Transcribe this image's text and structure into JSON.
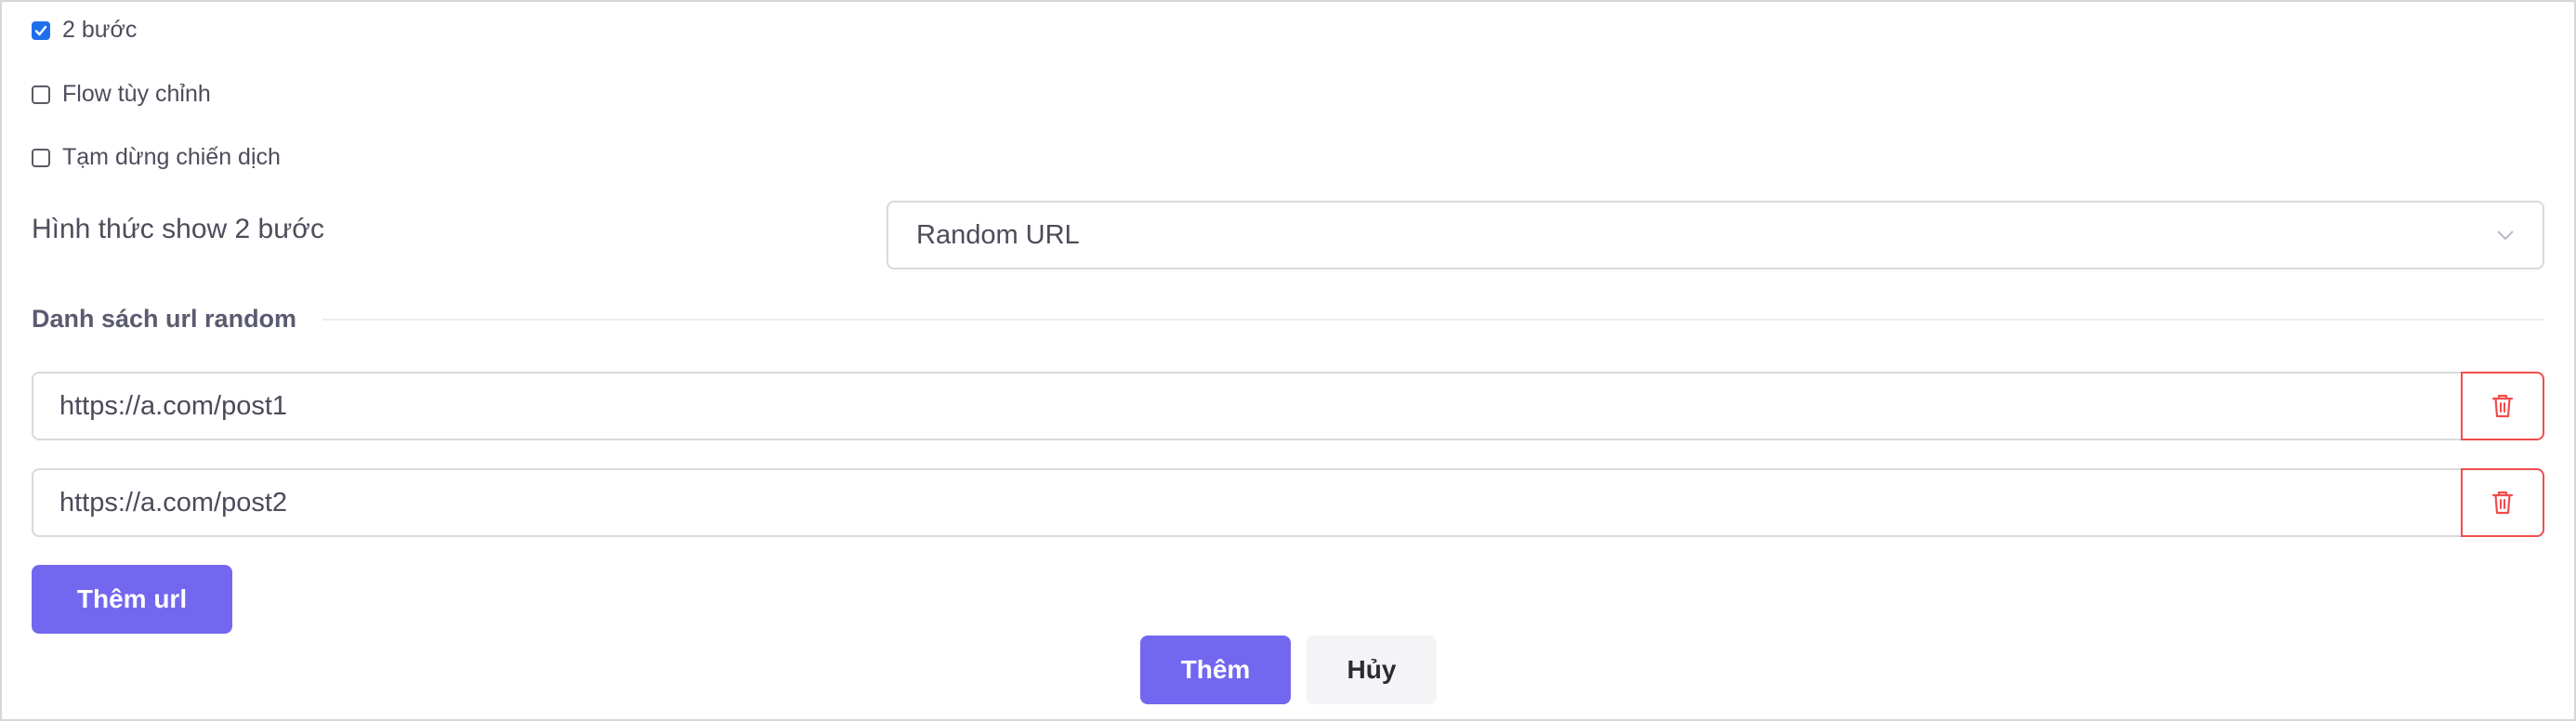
{
  "options": {
    "two_step": {
      "label": "2 bước",
      "checked": true
    },
    "custom_flow": {
      "label": "Flow tùy chỉnh",
      "checked": false
    },
    "pause_campaign": {
      "label": "Tạm dừng chiến dịch",
      "checked": false
    }
  },
  "display_mode": {
    "label": "Hình thức show 2 bước",
    "selected": "Random URL"
  },
  "url_list": {
    "title": "Danh sách url random",
    "items": [
      "https://a.com/post1",
      "https://a.com/post2"
    ],
    "add_label": "Thêm url"
  },
  "footer": {
    "submit_label": "Thêm",
    "cancel_label": "Hủy"
  },
  "colors": {
    "primary": "#7367f0",
    "danger": "#ef4d4d",
    "checkbox_checked": "#1f6feb"
  },
  "icons": {
    "delete": "trash-icon",
    "select_arrow": "chevron-down-icon",
    "check": "checkmark-icon"
  }
}
